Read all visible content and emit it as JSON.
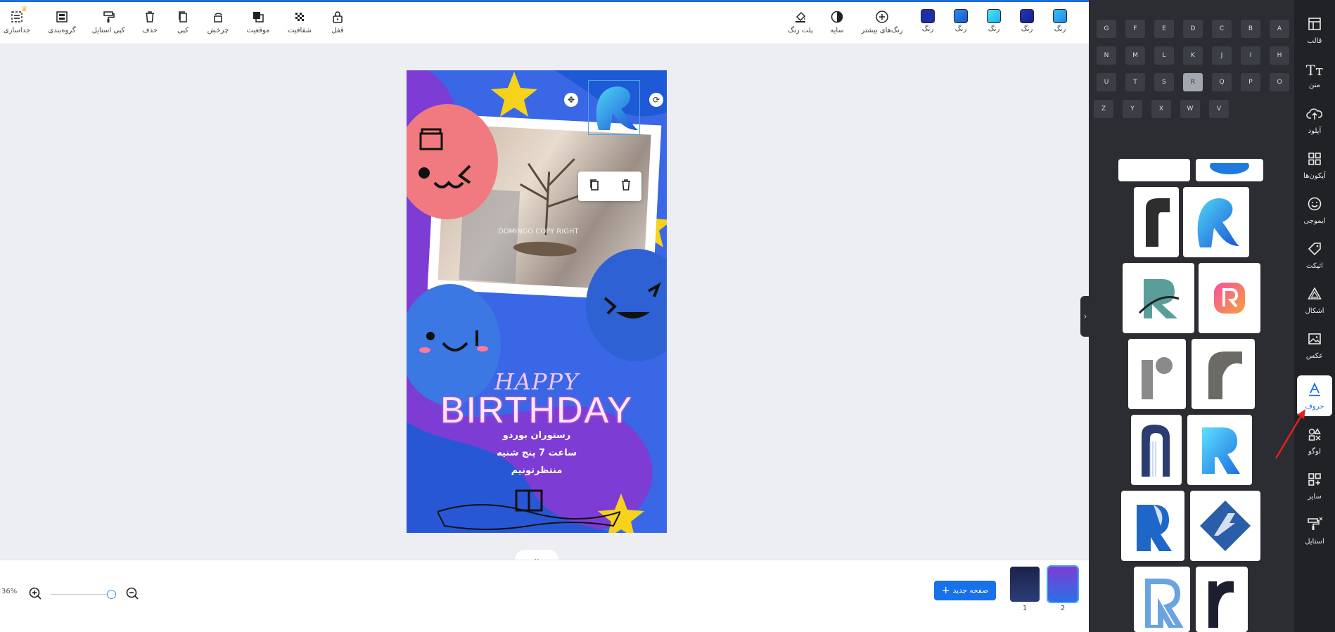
{
  "toolbar": {
    "left_tools": [
      {
        "name": "ungroup",
        "label": "جداسازی"
      },
      {
        "name": "group",
        "label": "گروه‌بندی"
      },
      {
        "name": "copy-style",
        "label": "کپی استایل"
      },
      {
        "name": "delete",
        "label": "حذف"
      },
      {
        "name": "copy",
        "label": "کپی"
      },
      {
        "name": "rotate",
        "label": "چرخش"
      },
      {
        "name": "position",
        "label": "موقعیت"
      },
      {
        "name": "opacity",
        "label": "شفافیت"
      },
      {
        "name": "lock",
        "label": "قفل"
      }
    ],
    "right_tools": [
      {
        "name": "palette",
        "label": "پلت رنگ"
      },
      {
        "name": "shade",
        "label": "سایه"
      },
      {
        "name": "more-colors",
        "label": "رنگ‌های بیشتر"
      }
    ],
    "color_label": "رنگ",
    "colors": [
      "#1c2fa8",
      "#2a8ef0",
      "#27d0f0",
      "#1a2ea0",
      "#1fa0ec"
    ]
  },
  "zoom": {
    "text": "36%"
  },
  "new_page": {
    "label": "صفحه جدید"
  },
  "pages": {
    "items": [
      "1",
      "2"
    ]
  },
  "design": {
    "watermark": "DOMINGO COPY RIGHT",
    "happy": "HAPPY",
    "birthday": "BIRTHDAY",
    "line1": "رستوران بوردو",
    "line2": "ساعت 7 پنج شنیه",
    "line3": "منتظرتونیم"
  },
  "letters": [
    "A",
    "B",
    "C",
    "D",
    "E",
    "F",
    "G",
    "H",
    "I",
    "J",
    "K",
    "L",
    "M",
    "N",
    "O",
    "P",
    "Q",
    "R",
    "S",
    "T",
    "U",
    "V",
    "W",
    "X",
    "Y",
    "Z"
  ],
  "selected_letter": "R",
  "nav": {
    "items": [
      {
        "name": "template",
        "label": "قالب"
      },
      {
        "name": "text",
        "label": "متن"
      },
      {
        "name": "upload",
        "label": "آپلود"
      },
      {
        "name": "icons",
        "label": "آیکون‌ها"
      },
      {
        "name": "emoji",
        "label": "ایموجی"
      },
      {
        "name": "label",
        "label": "اتیکت"
      },
      {
        "name": "shapes",
        "label": "اشکال"
      },
      {
        "name": "photo",
        "label": "عکس"
      },
      {
        "name": "letters",
        "label": "حروف"
      },
      {
        "name": "logo",
        "label": "لوگو"
      },
      {
        "name": "other",
        "label": "سایر"
      },
      {
        "name": "style",
        "label": "استایل"
      }
    ],
    "active": "letters"
  },
  "colors": {
    "accent": "#1871e8",
    "panel": "#2b2d32",
    "nav": "#202226",
    "design_bg": "#7d3cd3"
  }
}
